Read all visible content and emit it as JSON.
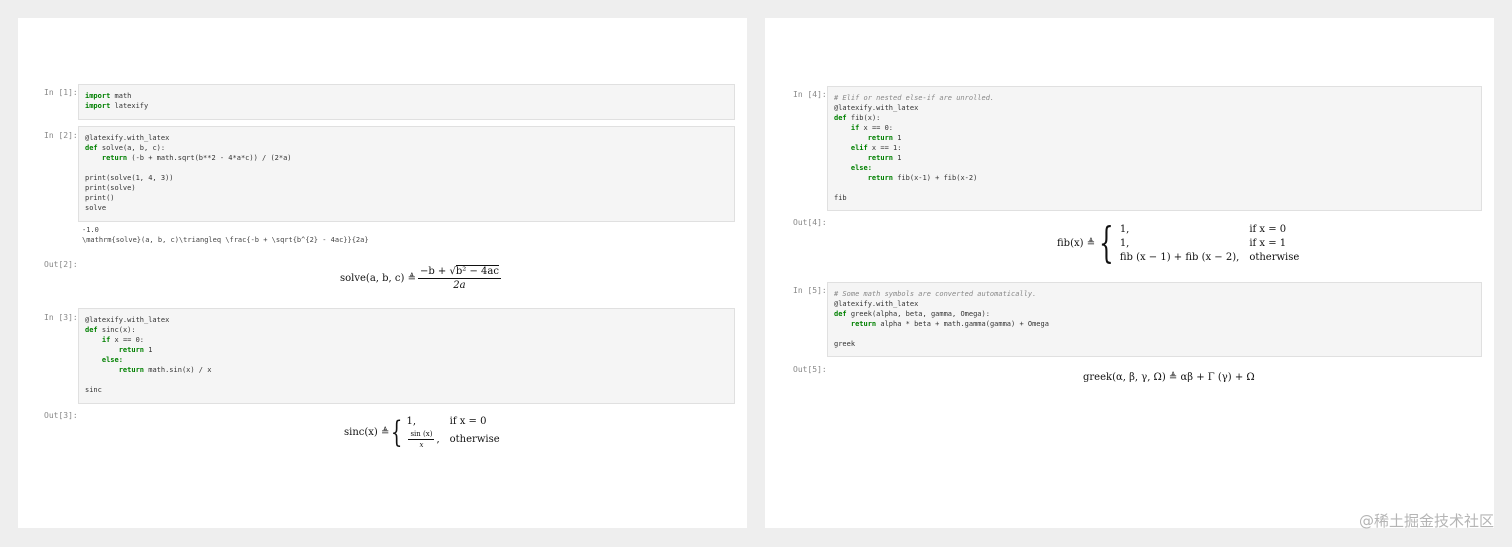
{
  "left_page": {
    "cell1": {
      "prompt": "In [1]:",
      "line1_kw": "import",
      "line1_rest": " math",
      "line2_kw": "import",
      "line2_rest": " latexify"
    },
    "cell2": {
      "prompt": "In [2]:",
      "decorator": "@latexify.with_latex",
      "def_kw": "def",
      "def_rest": " solve(a, b, c):",
      "return_kw": "return",
      "return_rest": " (-b + math.sqrt(b**2 - 4*a*c)) / (2*a)",
      "print1": "print(solve(1, 4, 3))",
      "print2": "print(solve)",
      "print3": "print()",
      "last": "solve"
    },
    "cell2_stream": {
      "line1": "-1.0",
      "line2": "\\mathrm{solve}(a, b, c)\\triangleq \\frac{-b + \\sqrt{b^{2} - 4ac}}{2a}"
    },
    "out2": {
      "prompt": "Out[2]:",
      "lhs": "solve(a, b, c) ≜",
      "numerator_pre": "−b + √",
      "radicand": "b² − 4ac",
      "denominator": "2a"
    },
    "cell3": {
      "prompt": "In [3]:",
      "decorator": "@latexify.with_latex",
      "def_kw": "def",
      "def_rest": " sinc(x):",
      "if_kw": "if",
      "if_rest": " x == 0:",
      "return1_kw": "return",
      "return1_rest": " 1",
      "else_kw": "else:",
      "return2_kw": "return",
      "return2_rest": " math.sin(x) / x",
      "last": "sinc"
    },
    "out3": {
      "prompt": "Out[3]:",
      "lhs": "sinc(x) ≜",
      "case1_val": "1,",
      "case1_cond": "if x = 0",
      "case2_num": "sin (x)",
      "case2_den": "x",
      "case2_comma": ",",
      "case2_cond": "otherwise"
    }
  },
  "right_page": {
    "cell4": {
      "prompt": "In [4]:",
      "comment": "# Elif or nested else-if are unrolled.",
      "decorator": "@latexify.with_latex",
      "def_kw": "def",
      "def_rest": " fib(x):",
      "if_kw": "if",
      "if_rest": " x == 0:",
      "return1_kw": "return",
      "return1_rest": " 1",
      "elif_kw": "elif",
      "elif_rest": " x == 1:",
      "return2_kw": "return",
      "return2_rest": " 1",
      "else_kw": "else:",
      "return3_kw": "return",
      "return3_rest": " fib(x-1) + fib(x-2)",
      "last": "fib"
    },
    "out4": {
      "prompt": "Out[4]:",
      "lhs": "fib(x) ≜",
      "case1_val": "1,",
      "case1_cond": "if x = 0",
      "case2_val": "1,",
      "case2_cond": "if x = 1",
      "case3_val": "fib (x − 1) + fib (x − 2),",
      "case3_cond": "otherwise"
    },
    "cell5": {
      "prompt": "In [5]:",
      "comment": "# Some math symbols are converted automatically.",
      "decorator": "@latexify.with_latex",
      "def_kw": "def",
      "def_rest": " greek(alpha, beta, gamma, Omega):",
      "return_kw": "return",
      "return_rest": " alpha * beta + math.gamma(gamma) + Omega",
      "last": "greek"
    },
    "out5": {
      "prompt": "Out[5]:",
      "expr": "greek(α, β, γ, Ω) ≜ αβ + Γ (γ) + Ω"
    }
  },
  "watermark": "@稀土掘金技术社区"
}
